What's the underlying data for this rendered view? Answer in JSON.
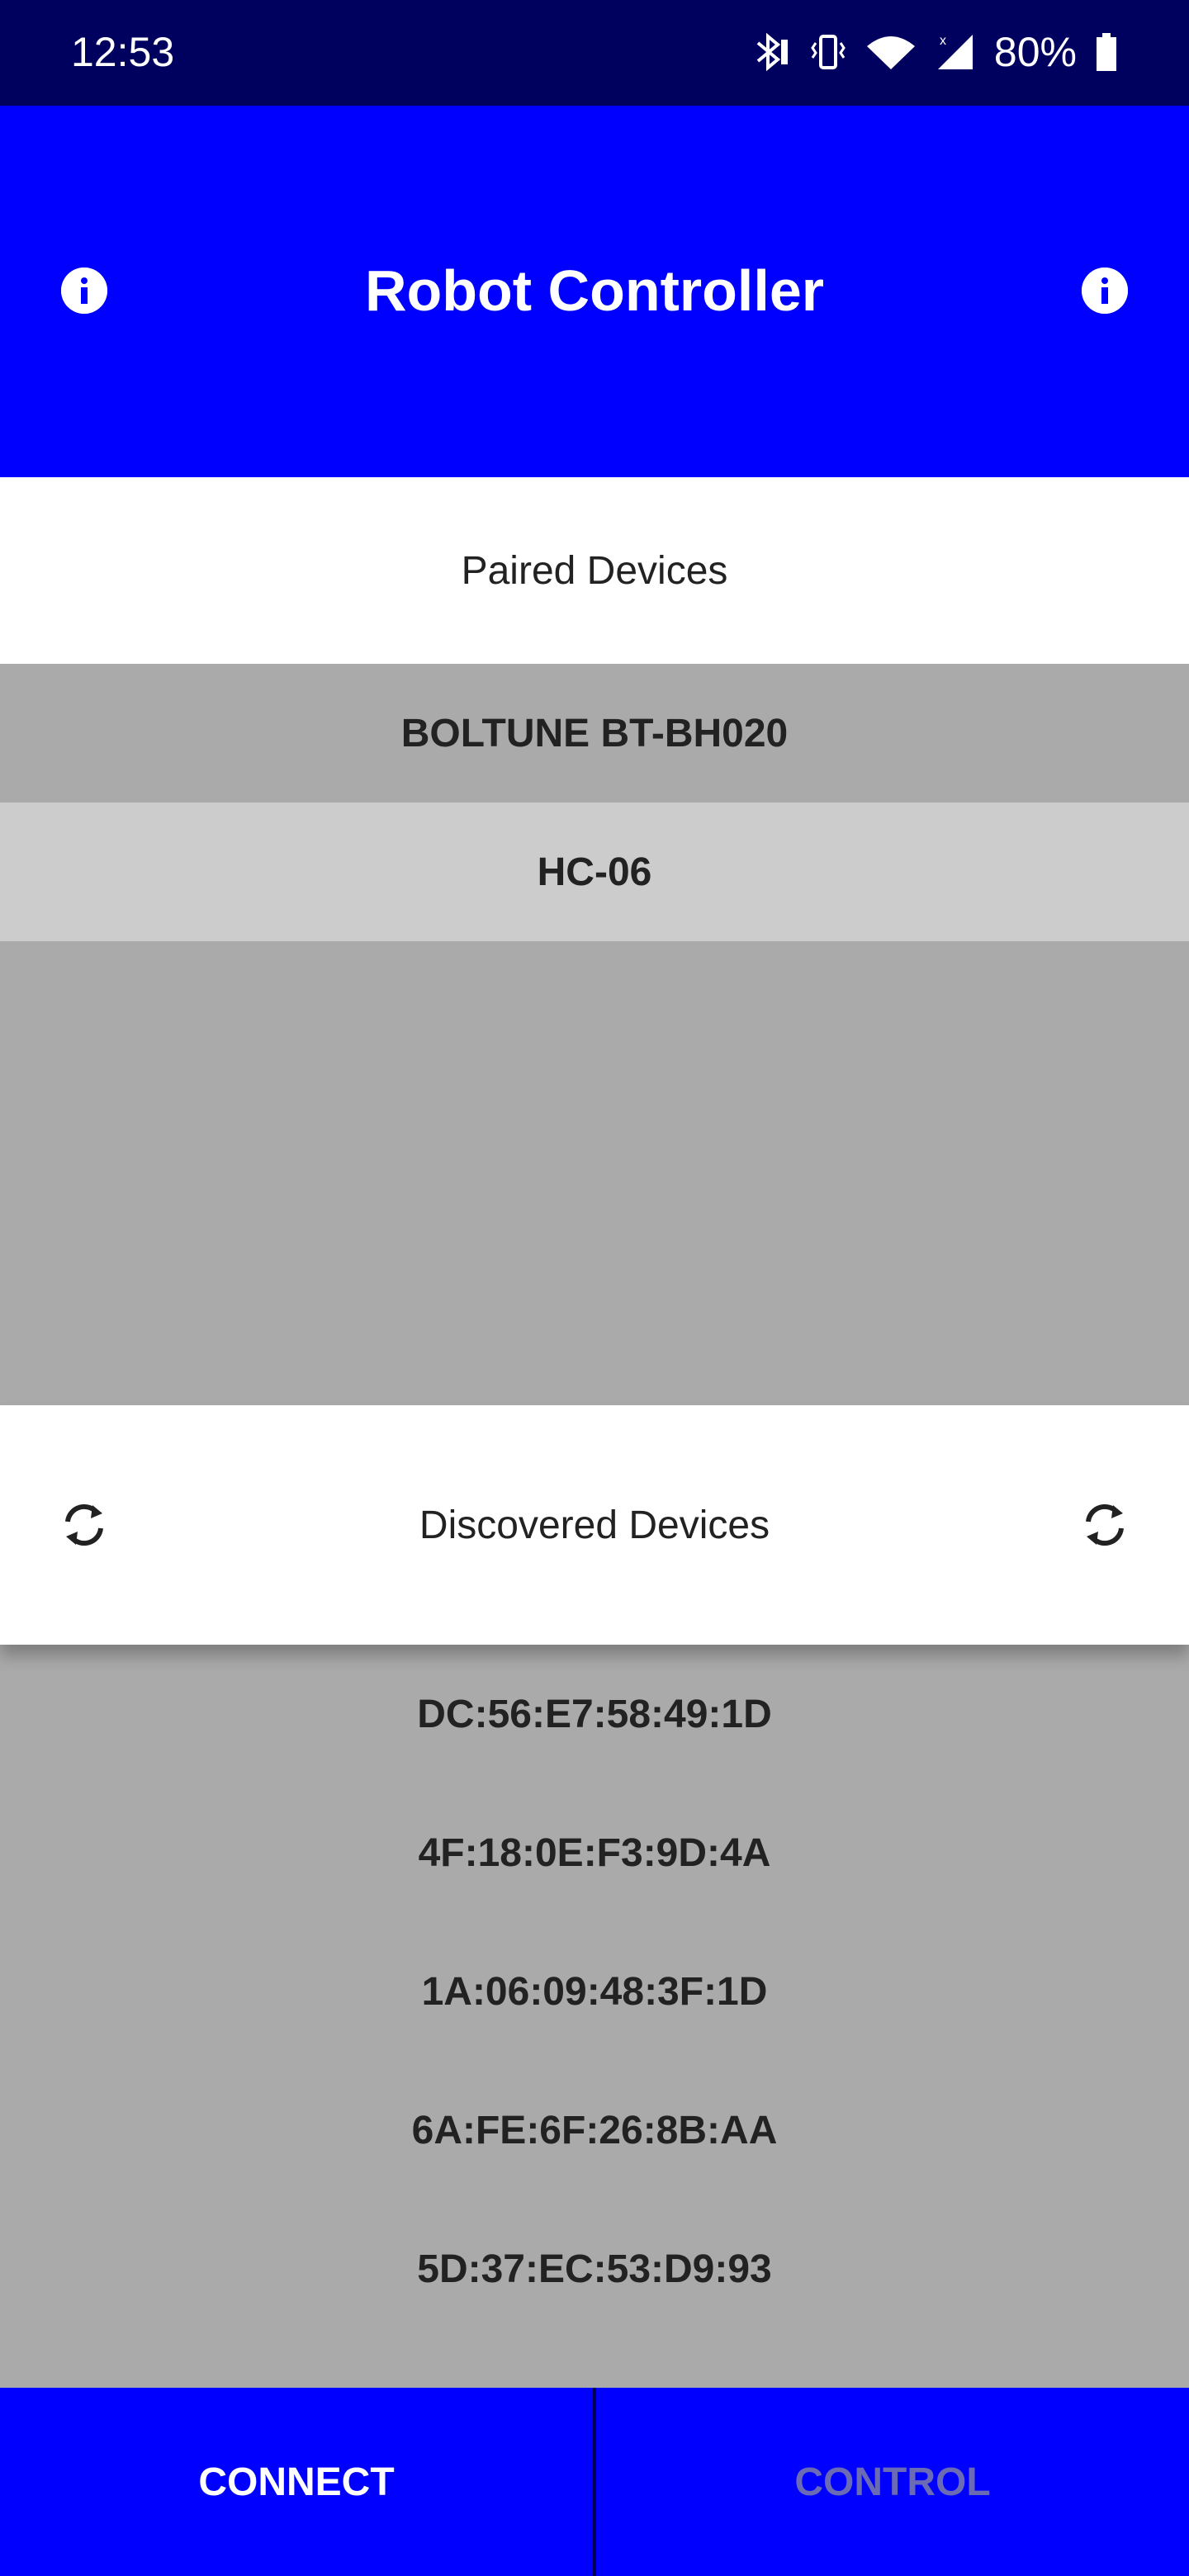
{
  "status_bar": {
    "time": "12:53",
    "battery_percent": "80%",
    "icons": [
      "bluetooth-icon",
      "vibrate-icon",
      "wifi-icon",
      "signal-icon",
      "battery-icon"
    ]
  },
  "app_bar": {
    "title": "Robot Controller",
    "left_icon": "info-icon",
    "right_icon": "info-icon"
  },
  "paired": {
    "header": "Paired Devices",
    "devices": [
      "BOLTUNE BT-BH020",
      "HC-06"
    ],
    "selected_index": 1
  },
  "discovered": {
    "header": "Discovered Devices",
    "left_icon": "refresh-icon",
    "right_icon": "refresh-icon",
    "devices": [
      "DC:56:E7:58:49:1D",
      "4F:18:0E:F3:9D:4A",
      "1A:06:09:48:3F:1D",
      "6A:FE:6F:26:8B:AA",
      "5D:37:EC:53:D9:93"
    ]
  },
  "bottom_bar": {
    "connect_label": "CONNECT",
    "control_label": "CONTROL"
  },
  "colors": {
    "status_bar": "#00005e",
    "primary": "#0000ff",
    "list_background": "#aaaaaa",
    "selected_row": "#cccccc",
    "disabled_text": "#6a6ab5"
  }
}
